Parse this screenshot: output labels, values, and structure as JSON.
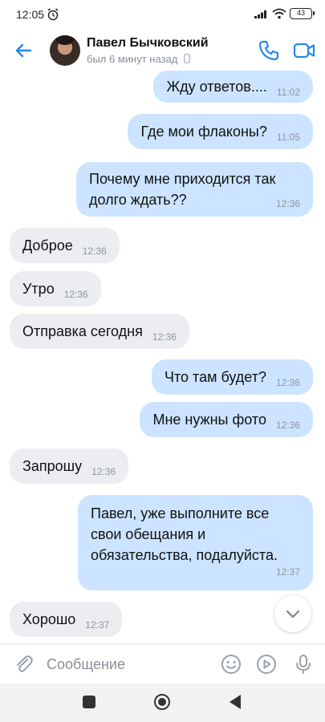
{
  "status_bar": {
    "time": "12:05",
    "battery": "43"
  },
  "header": {
    "contact_name": "Павел Бычковский",
    "contact_status": "был 6 минут назад"
  },
  "messages": [
    {
      "direction": "out",
      "text": "Жду ответов....",
      "time": "11:02"
    },
    {
      "direction": "out",
      "text": "Где мои флаконы?",
      "time": "11:05"
    },
    {
      "direction": "out",
      "lines": [
        "Почему мне приходится так",
        "долго ждать??"
      ],
      "time": "12:36"
    },
    {
      "direction": "in",
      "text": "Доброе",
      "time": "12:36"
    },
    {
      "direction": "in",
      "text": "Утро",
      "time": "12:36"
    },
    {
      "direction": "in",
      "text": "Отправка сегодня",
      "time": "12:36"
    },
    {
      "direction": "out",
      "text": "Что там будет?",
      "time": "12:36"
    },
    {
      "direction": "out",
      "text": "Мне нужны фото",
      "time": "12:36"
    },
    {
      "direction": "in",
      "text": "Запрошу",
      "time": "12:36"
    },
    {
      "direction": "out",
      "lines": [
        "Павел, уже выполните все",
        "свои обещания и",
        "обязательства, подалуйста."
      ],
      "time": "12:37"
    },
    {
      "direction": "in",
      "text": "Хорошо",
      "time": "12:37"
    }
  ],
  "composer": {
    "placeholder": "Сообщение"
  },
  "colors": {
    "accent": "#2688eb",
    "outgoing_bubble": "#cce4ff",
    "incoming_bubble": "#ebedf0"
  },
  "icons": {
    "back": "arrow-left-icon",
    "call": "phone-icon",
    "video": "video-camera-icon",
    "attach": "paperclip-icon",
    "emoji": "smile-icon",
    "sticker": "play-circle-icon",
    "voice": "microphone-icon",
    "scroll": "chevron-down-icon"
  }
}
